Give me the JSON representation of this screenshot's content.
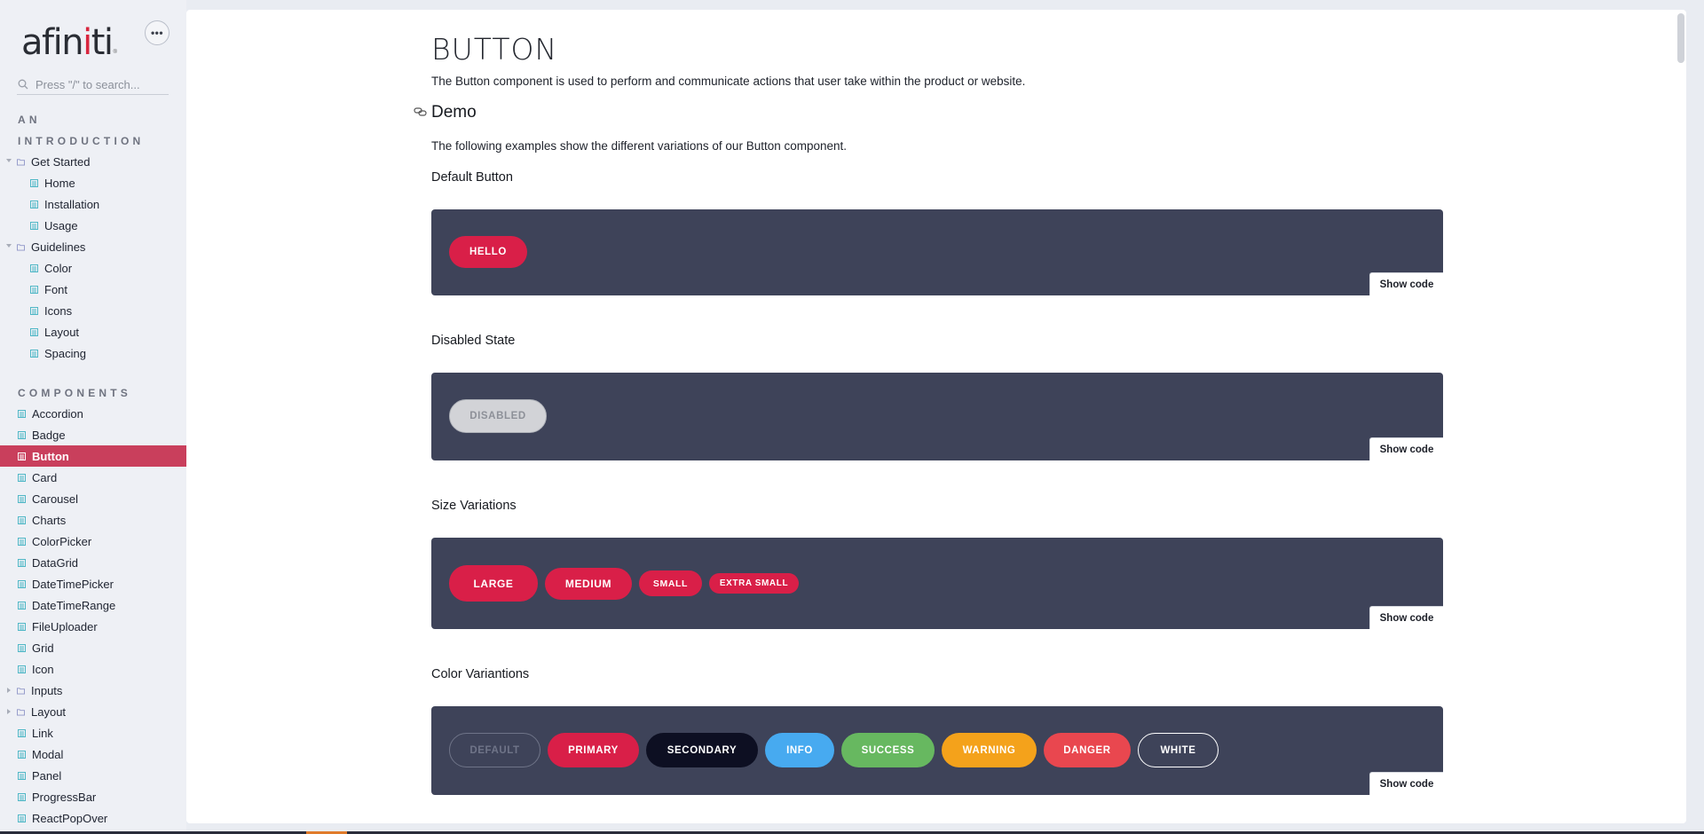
{
  "brand": {
    "logo_text_a": "afin",
    "logo_text_i": "i",
    "logo_text_b": "ti",
    "logo_mark": "®",
    "accent_color": "#d91f48",
    "sidebar_active_color": "#c93f5c",
    "demo_bg_color": "#3e4359"
  },
  "sidebar": {
    "more_icon": "ellipsis-icon",
    "more_label": "•••",
    "search_placeholder": "Press \"/\" to search...",
    "sections": [
      {
        "title_line1": "AN",
        "title_line2": "INTRODUCTION",
        "items": [
          {
            "label": "Get Started",
            "type": "folder",
            "expanded": true
          },
          {
            "label": "Home",
            "type": "page"
          },
          {
            "label": "Installation",
            "type": "page"
          },
          {
            "label": "Usage",
            "type": "page"
          },
          {
            "label": "Guidelines",
            "type": "folder",
            "expanded": true
          },
          {
            "label": "Color",
            "type": "page"
          },
          {
            "label": "Font",
            "type": "page"
          },
          {
            "label": "Icons",
            "type": "page"
          },
          {
            "label": "Layout",
            "type": "page"
          },
          {
            "label": "Spacing",
            "type": "page"
          }
        ]
      },
      {
        "title": "COMPONENTS",
        "items": [
          {
            "label": "Accordion",
            "type": "page"
          },
          {
            "label": "Badge",
            "type": "page"
          },
          {
            "label": "Button",
            "type": "page",
            "active": true
          },
          {
            "label": "Card",
            "type": "page"
          },
          {
            "label": "Carousel",
            "type": "page"
          },
          {
            "label": "Charts",
            "type": "page"
          },
          {
            "label": "ColorPicker",
            "type": "page"
          },
          {
            "label": "DataGrid",
            "type": "page"
          },
          {
            "label": "DateTimePicker",
            "type": "page"
          },
          {
            "label": "DateTimeRange",
            "type": "page"
          },
          {
            "label": "FileUploader",
            "type": "page"
          },
          {
            "label": "Grid",
            "type": "page"
          },
          {
            "label": "Icon",
            "type": "page"
          },
          {
            "label": "Inputs",
            "type": "folder",
            "expanded": false
          },
          {
            "label": "Layout",
            "type": "folder",
            "expanded": false
          },
          {
            "label": "Link",
            "type": "page"
          },
          {
            "label": "Modal",
            "type": "page"
          },
          {
            "label": "Panel",
            "type": "page"
          },
          {
            "label": "ProgressBar",
            "type": "page"
          },
          {
            "label": "ReactPopOver",
            "type": "page"
          }
        ]
      }
    ]
  },
  "main": {
    "title": "BUTTON",
    "intro": "The Button component is used to perform and communicate actions that user take within the product or website.",
    "demo_heading": "Demo",
    "demo_intro": "The following examples show the different variations of our Button component.",
    "show_code_label": "Show code",
    "examples": {
      "default": {
        "heading": "Default Button",
        "button": "HELLO"
      },
      "disabled": {
        "heading": "Disabled State",
        "button": "DISABLED"
      },
      "sizes": {
        "heading": "Size Variations",
        "buttons": [
          "LARGE",
          "MEDIUM",
          "SMALL",
          "EXTRA SMALL"
        ]
      },
      "colors": {
        "heading": "Color Variantions",
        "buttons": [
          "DEFAULT",
          "PRIMARY",
          "SECONDARY",
          "INFO",
          "SUCCESS",
          "WARNING",
          "DANGER",
          "WHITE"
        ]
      }
    }
  }
}
